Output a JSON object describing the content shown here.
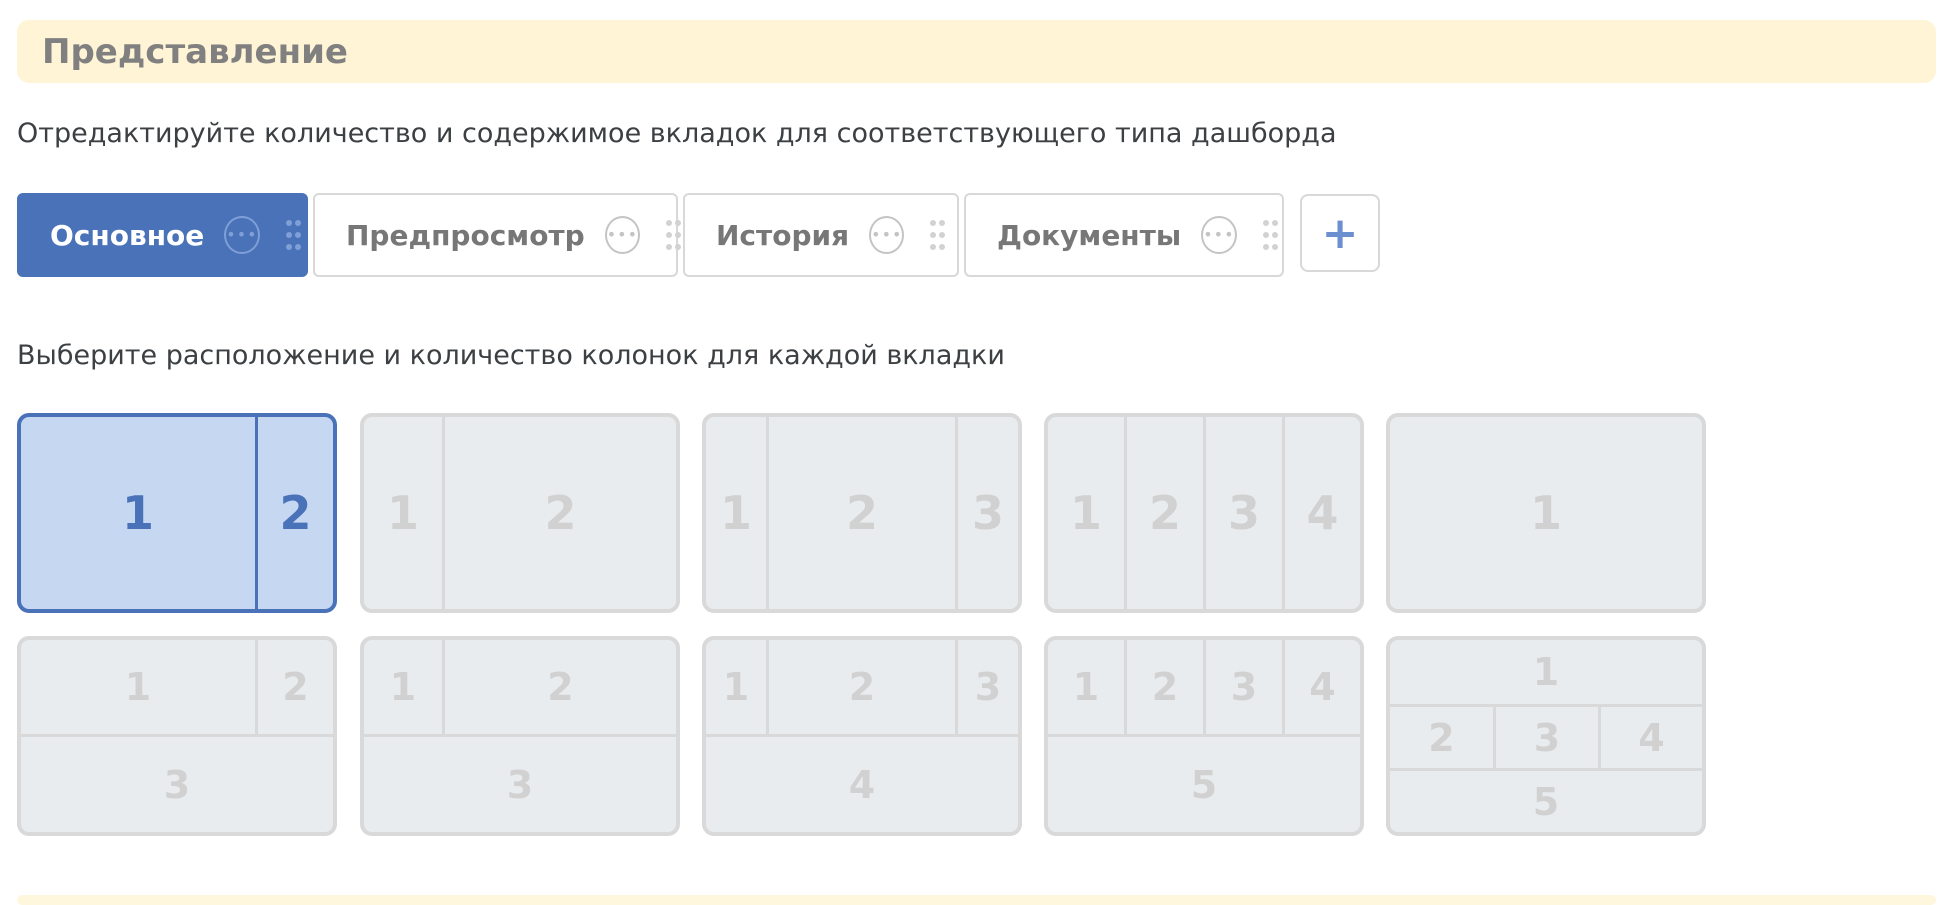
{
  "section": {
    "title": "Представление"
  },
  "tabs_description": "Отредактируйте количество и содержимое вкладок для соответствующего типа дашборда",
  "tabs": [
    {
      "label": "Основное",
      "active": true
    },
    {
      "label": "Предпросмотр",
      "active": false
    },
    {
      "label": "История",
      "active": false
    },
    {
      "label": "Документы",
      "active": false
    }
  ],
  "add_tab_label": "+",
  "layouts_description": "Выберите расположение и количество колонок для каждой вкладки",
  "layouts": {
    "row1": [
      {
        "cells": [
          "1",
          "2"
        ],
        "selected": true
      },
      {
        "cells": [
          "1",
          "2"
        ],
        "selected": false
      },
      {
        "cells": [
          "1",
          "2",
          "3"
        ],
        "selected": false
      },
      {
        "cells": [
          "1",
          "2",
          "3",
          "4"
        ],
        "selected": false
      },
      {
        "cells": [
          "1"
        ],
        "selected": false
      }
    ],
    "row2": [
      {
        "cells": [
          "1",
          "2",
          "3"
        ],
        "selected": false
      },
      {
        "cells": [
          "1",
          "2",
          "3"
        ],
        "selected": false
      },
      {
        "cells": [
          "1",
          "2",
          "3",
          "4"
        ],
        "selected": false
      },
      {
        "cells": [
          "1",
          "2",
          "3",
          "4",
          "5"
        ],
        "selected": false
      },
      {
        "cells": [
          "1",
          "2",
          "3",
          "4",
          "5"
        ],
        "selected": false
      }
    ]
  },
  "icons": {
    "tab_more": "more-horizontal-icon",
    "tab_drag": "drag-handle-icon",
    "add": "plus-icon"
  },
  "colors": {
    "accent": "#4a72b8",
    "selected_bg": "#c6d7f2",
    "header_bg": "#fff4d6",
    "layout_bg": "#e9ecee"
  }
}
